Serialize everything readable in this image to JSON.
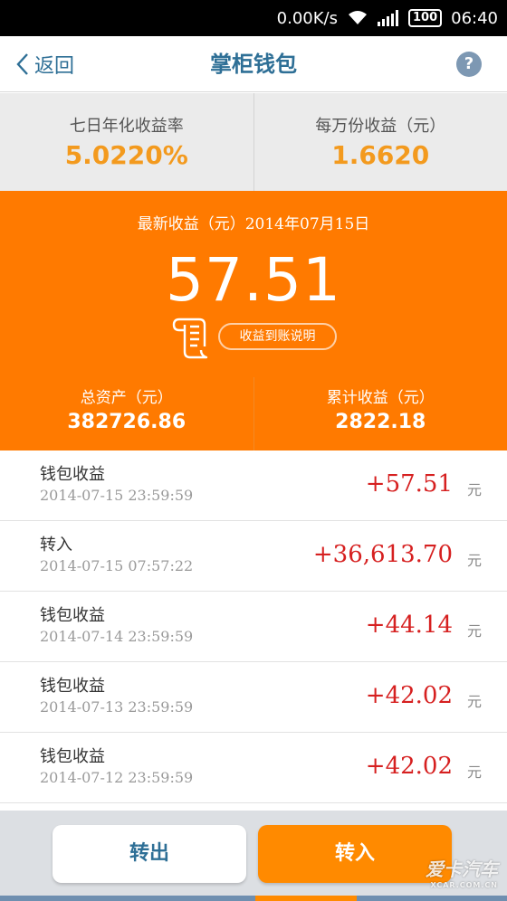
{
  "status_bar": {
    "speed": "0.00K/s",
    "battery": "100",
    "time": "06:40"
  },
  "nav": {
    "back_label": "返回",
    "title": "掌柜钱包",
    "help_label": "?"
  },
  "rates": {
    "seven_day_label": "七日年化收益率",
    "seven_day_value": "5.0220%",
    "per_10k_label": "每万份收益（元）",
    "per_10k_value": "1.6620"
  },
  "earnings": {
    "latest_label": "最新收益（元）2014年07月15日",
    "latest_amount": "57.51",
    "explain_button": "收益到账说明",
    "total_assets_label": "总资产（元）",
    "total_assets_value": "382726.86",
    "cumulative_label": "累计收益（元）",
    "cumulative_value": "2822.18"
  },
  "transactions": [
    {
      "type": "钱包收益",
      "time": "2014-07-15 23:59:59",
      "amount": "+57.51",
      "unit": "元"
    },
    {
      "type": "转入",
      "time": "2014-07-15 07:57:22",
      "amount": "+36,613.70",
      "unit": "元"
    },
    {
      "type": "钱包收益",
      "time": "2014-07-14 23:59:59",
      "amount": "+44.14",
      "unit": "元"
    },
    {
      "type": "钱包收益",
      "time": "2014-07-13 23:59:59",
      "amount": "+42.02",
      "unit": "元"
    },
    {
      "type": "钱包收益",
      "time": "2014-07-12 23:59:59",
      "amount": "+42.02",
      "unit": "元"
    }
  ],
  "actions": {
    "transfer_out": "转出",
    "transfer_in": "转入"
  },
  "watermark": {
    "text": "爱卡汽车",
    "sub": "XCAR.COM.CN"
  },
  "colors": {
    "accent_orange": "#ff7a00",
    "title_blue": "#2e6f96",
    "amount_red": "#d62020",
    "rate_orange": "#f39a1e"
  }
}
